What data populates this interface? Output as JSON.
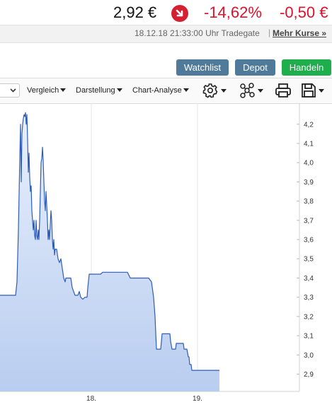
{
  "quote": {
    "price": "2,92 €",
    "change_pct": "-14,62%",
    "change_abs": "-0,50 €",
    "timestamp": "18.12.18 21:33:00 Uhr Tradegate",
    "separator": "|",
    "more_link": "Mehr Kurse »"
  },
  "actions": {
    "watchlist": "Watchlist",
    "depot": "Depot",
    "handeln": "Handeln"
  },
  "toolbar": {
    "vergleich": "Vergleich",
    "darstellung": "Darstellung",
    "chart_analyse": "Chart-Analyse",
    "icons": [
      "settings-icon",
      "network-icon",
      "print-icon",
      "save-icon"
    ]
  },
  "colors": {
    "negative": "#e0112b",
    "line": "#2e5cb8",
    "area_top": "#e8f0fc",
    "area_bottom": "#b9cdf0",
    "btn_blue": "#4f7a99",
    "btn_green": "#1fae4c"
  },
  "chart_data": {
    "type": "area",
    "title": "",
    "xlabel": "",
    "ylabel": "",
    "ylim": [
      2.81,
      4.28
    ],
    "y_ticks": [
      "4,2",
      "4,1",
      "4,0",
      "3,9",
      "3,8",
      "3,7",
      "3,6",
      "3,5",
      "3,4",
      "3,3",
      "3,2",
      "3,1",
      "3,0",
      "2,9"
    ],
    "x_ticks": [
      "18.",
      "19."
    ],
    "grid": true,
    "series": [
      {
        "values": [
          [
            0,
            3.31
          ],
          [
            22,
            3.31
          ],
          [
            24,
            3.38
          ],
          [
            26,
            3.65
          ],
          [
            28,
            4.03
          ],
          [
            29,
            4.2
          ],
          [
            30,
            3.9
          ],
          [
            31,
            4.15
          ],
          [
            32,
            4.2
          ],
          [
            33,
            4.23
          ],
          [
            34,
            4.25
          ],
          [
            35,
            4.24
          ],
          [
            36,
            4.26
          ],
          [
            37,
            4.2
          ],
          [
            38,
            4.25
          ],
          [
            39,
            4.12
          ],
          [
            40,
            3.95
          ],
          [
            41,
            4.05
          ],
          [
            42,
            3.92
          ],
          [
            43,
            3.85
          ],
          [
            44,
            3.88
          ],
          [
            45,
            3.75
          ],
          [
            46,
            3.7
          ],
          [
            47,
            3.65
          ],
          [
            48,
            3.7
          ],
          [
            49,
            3.62
          ],
          [
            50,
            3.6
          ],
          [
            51,
            3.7
          ],
          [
            52,
            3.62
          ],
          [
            53,
            3.6
          ],
          [
            54,
            3.65
          ],
          [
            55,
            3.6
          ],
          [
            56,
            3.7
          ],
          [
            57,
            3.85
          ],
          [
            58,
            4.0
          ],
          [
            59,
            4.02
          ],
          [
            60,
            4.08
          ],
          [
            61,
            4.01
          ],
          [
            62,
            3.9
          ],
          [
            63,
            3.8
          ],
          [
            64,
            3.75
          ],
          [
            65,
            3.85
          ],
          [
            66,
            3.78
          ],
          [
            67,
            3.7
          ],
          [
            68,
            3.6
          ],
          [
            69,
            3.65
          ],
          [
            70,
            3.6
          ],
          [
            71,
            3.68
          ],
          [
            72,
            3.75
          ],
          [
            73,
            3.7
          ],
          [
            74,
            3.6
          ],
          [
            75,
            3.55
          ],
          [
            76,
            3.6
          ],
          [
            77,
            3.52
          ],
          [
            78,
            3.55
          ],
          [
            80,
            3.55
          ],
          [
            82,
            3.5
          ],
          [
            84,
            3.48
          ],
          [
            86,
            3.5
          ],
          [
            88,
            3.45
          ],
          [
            90,
            3.4
          ],
          [
            92,
            3.38
          ],
          [
            93,
            3.4
          ],
          [
            96,
            3.4
          ],
          [
            100,
            3.4
          ],
          [
            102,
            3.35
          ],
          [
            104,
            3.33
          ],
          [
            106,
            3.31
          ],
          [
            110,
            3.31
          ],
          [
            112,
            3.33
          ],
          [
            114,
            3.3
          ],
          [
            117,
            3.29
          ],
          [
            120,
            3.3
          ],
          [
            123,
            3.3
          ],
          [
            124,
            3.35
          ],
          [
            126,
            3.42
          ],
          [
            128,
            3.42
          ],
          [
            142,
            3.42
          ],
          [
            145,
            3.43
          ],
          [
            150,
            3.43
          ],
          [
            178,
            3.43
          ],
          [
            180,
            3.43
          ],
          [
            184,
            3.4
          ],
          [
            200,
            3.4
          ],
          [
            210,
            3.4
          ],
          [
            214,
            3.38
          ],
          [
            217,
            3.3
          ],
          [
            219,
            3.2
          ],
          [
            221,
            3.03
          ],
          [
            222,
            3.03
          ],
          [
            227,
            3.03
          ],
          [
            229,
            3.11
          ],
          [
            231,
            3.11
          ],
          [
            240,
            3.11
          ],
          [
            241,
            3.07
          ],
          [
            243,
            3.03
          ],
          [
            245,
            3.03
          ],
          [
            248,
            3.03
          ],
          [
            249,
            3.06
          ],
          [
            252,
            3.06
          ],
          [
            259,
            3.06
          ],
          [
            260,
            3.03
          ],
          [
            264,
            3.03
          ],
          [
            266,
            2.99
          ],
          [
            267,
            2.99
          ],
          [
            268,
            2.95
          ],
          [
            270,
            2.95
          ],
          [
            271,
            2.92
          ],
          [
            273,
            2.92
          ],
          [
            282,
            2.92
          ],
          [
            292,
            2.92
          ],
          [
            302,
            2.92
          ],
          [
            310,
            2.92
          ]
        ]
      }
    ]
  }
}
